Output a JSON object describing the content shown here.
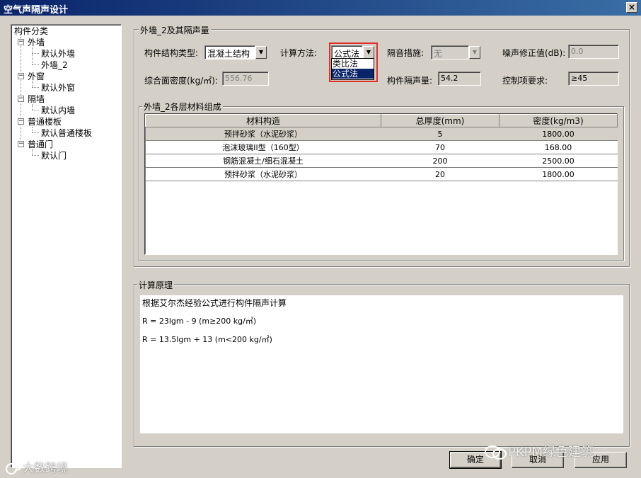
{
  "window": {
    "title": "空气声隔声设计",
    "close_glyph": "×"
  },
  "tree": {
    "root": "构件分类",
    "nodes": [
      {
        "label": "外墙",
        "children": [
          "默认外墙",
          "外墙_2"
        ]
      },
      {
        "label": "外窗",
        "children": [
          "默认外窗"
        ]
      },
      {
        "label": "隔墙",
        "children": [
          "默认内墙"
        ]
      },
      {
        "label": "普通楼板",
        "children": [
          "默认普通楼板"
        ]
      },
      {
        "label": "普通门",
        "children": [
          "默认门"
        ]
      }
    ],
    "expander_glyph": "−"
  },
  "props_group": {
    "title": "外墙_2及其隔声量",
    "structure_type_label": "构件结构类型:",
    "structure_type_value": "混凝土结构",
    "calc_method_label": "计算方法:",
    "calc_method_value": "公式法",
    "calc_method_options": [
      "类比法",
      "公式法"
    ],
    "calc_method_selected_index": 1,
    "measure_label": "隔音措施:",
    "measure_value": "无",
    "noise_correction_label": "噪声修正值(dB):",
    "noise_correction_value": "0.0",
    "areal_density_label": "综合面密度(kg/㎡):",
    "areal_density_value": "556.76",
    "insulation_label": "构件隔声量:",
    "insulation_value": "54.2",
    "control_label": "控制项要求:",
    "control_value": "≥45"
  },
  "materials_group": {
    "title": "外墙_2各层材料组成",
    "columns": [
      "材料构造",
      "总厚度(mm)",
      "密度(kg/m3)"
    ],
    "rows": [
      [
        "预拌砂浆（水泥砂浆）",
        "5",
        "1800.00"
      ],
      [
        "泡沫玻璃II型（160型）",
        "70",
        "168.00"
      ],
      [
        "钢筋混凝土/细石混凝土",
        "200",
        "2500.00"
      ],
      [
        "预拌砂浆（水泥砂浆）",
        "20",
        "1800.00"
      ]
    ],
    "selected_row": 0
  },
  "calc_group": {
    "title": "计算原理",
    "lines": [
      "根据艾尔杰经验公式进行构件隔声计算",
      "R = 23lgm - 9    (m≥200 kg/㎡)",
      "R = 13.5lgm + 13  (m<200 kg/㎡)"
    ]
  },
  "buttons": {
    "ok": "确定",
    "cancel": "取消",
    "apply": "应用"
  },
  "watermarks": {
    "brand": "PKPM绿色建筑",
    "site": "大数跨境"
  },
  "icons": {
    "dropdown": "▼"
  },
  "colors": {
    "titlebar": "#0a246a",
    "highlight_border": "#e0302c",
    "selection": "#0a246a"
  }
}
